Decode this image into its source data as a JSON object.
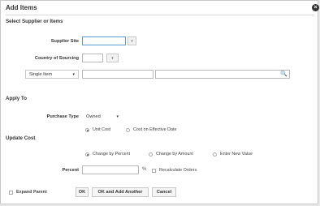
{
  "dialog": {
    "title": "Add Items"
  },
  "select_section": {
    "heading": "Select Supplier or Items",
    "supplier_site_label": "Supplier Site",
    "supplier_site_value": "",
    "country_label": "Country of Sourcing",
    "country_value": "",
    "item_type": "Single Item",
    "item_value": "",
    "item_desc": ""
  },
  "apply_to": {
    "heading": "Apply To",
    "purchase_type_label": "Purchase Type",
    "purchase_type_value": "Owned",
    "unit_cost": "Unit Cost",
    "cost_effective": "Cost on Effective Date"
  },
  "update_cost": {
    "heading": "Update Cost",
    "change_percent": "Change by Percent",
    "change_amount": "Change by Amount",
    "new_value": "Enter New Value",
    "percent_label": "Percent",
    "percent_value": "",
    "percent_sign": "%",
    "recalc": "Recalculate Orders"
  },
  "footer": {
    "expand_parent": "Expand Parent",
    "ok": "OK",
    "ok_add": "OK and Add Another",
    "cancel": "Cancel"
  },
  "icons": {
    "dropdown": "▾",
    "close": "×",
    "search": "🔍"
  }
}
